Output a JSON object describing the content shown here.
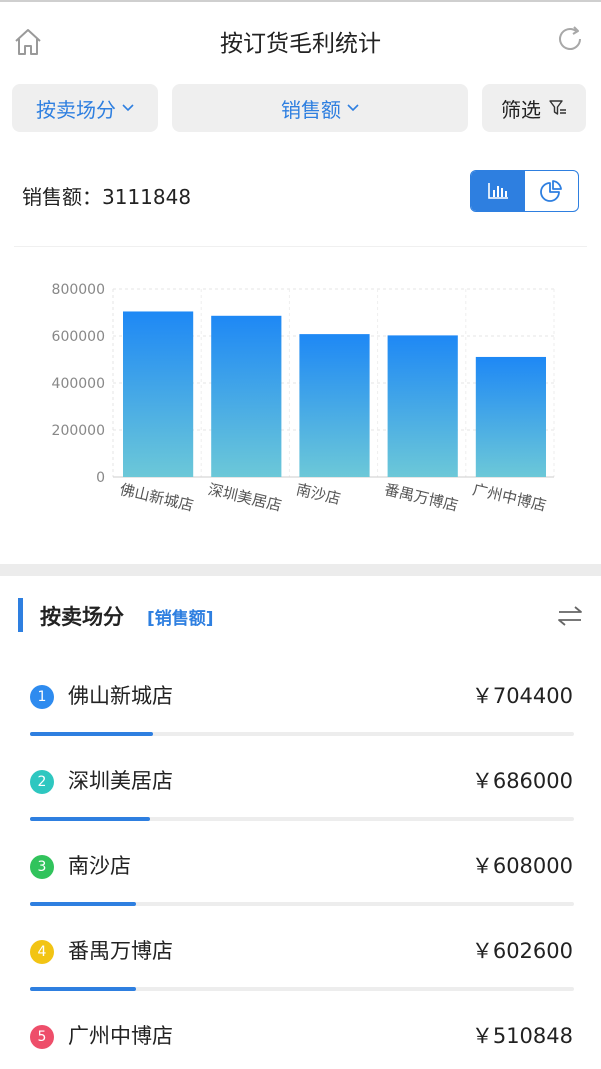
{
  "header": {
    "title": "按订货毛利统计",
    "home_icon": "home-icon",
    "refresh_icon": "refresh-icon"
  },
  "filters": {
    "group_by": "按卖场分",
    "metric": "销售额",
    "filter": "筛选"
  },
  "summary": {
    "label": "销售额：",
    "value": "3111848"
  },
  "chart_data": {
    "type": "bar",
    "categories": [
      "佛山新城店",
      "深圳美居店",
      "南沙店",
      "番禺万博店",
      "广州中博店"
    ],
    "values": [
      704400,
      686000,
      608000,
      602600,
      510848
    ],
    "ylim": [
      0,
      800000
    ],
    "yticks": [
      "800000",
      "600000",
      "400000",
      "200000",
      "0"
    ],
    "grid": true,
    "colors": {
      "top": "#1e88f5",
      "bottom": "#6cc8d8"
    }
  },
  "list": {
    "title": "按卖场分",
    "tag": "[销售额]",
    "rows": [
      {
        "rank": "1",
        "name": "佛山新城店",
        "value": "￥704400",
        "color": "#2e8bef",
        "fraction": 0.226
      },
      {
        "rank": "2",
        "name": "深圳美居店",
        "value": "￥686000",
        "color": "#2ec7c0",
        "fraction": 0.22
      },
      {
        "rank": "3",
        "name": "南沙店",
        "value": "￥608000",
        "color": "#31c35c",
        "fraction": 0.195
      },
      {
        "rank": "4",
        "name": "番禺万博店",
        "value": "￥602600",
        "color": "#f2c414",
        "fraction": 0.194
      },
      {
        "rank": "5",
        "name": "广州中博店",
        "value": "￥510848",
        "color": "#ee4e6a",
        "fraction": 0.164
      }
    ]
  },
  "accent": "#2e7fe0"
}
